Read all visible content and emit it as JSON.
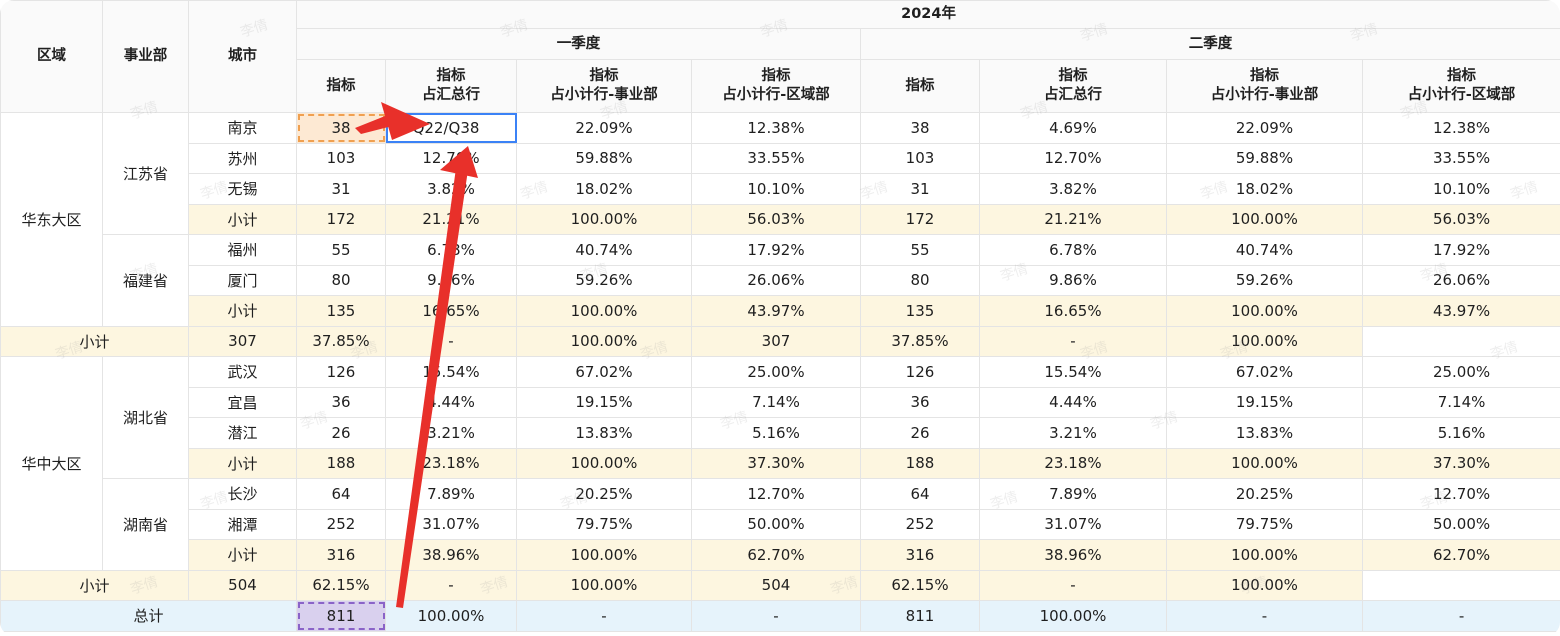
{
  "header": {
    "region": "区域",
    "bu": "事业部",
    "city": "城市",
    "year": "2024年",
    "q1": "一季度",
    "q2": "二季度",
    "metric": "指标",
    "m_total_l1": "指标",
    "m_total_l2": "占汇总行",
    "m_bu_l1": "指标",
    "m_bu_l2": "占小计行-事业部",
    "m_reg_l1": "指标",
    "m_reg_l2": "占小计行-区域部"
  },
  "formula": "=Q22/Q38",
  "rows": [
    {
      "city": "南京",
      "v": "38",
      "p1": "=Q22/Q38",
      "p2": "22.09%",
      "p3": "12.38%",
      "w": "38",
      "q1": "4.69%",
      "q2": "22.09%",
      "q3": "12.38%"
    },
    {
      "city": "苏州",
      "v": "103",
      "p1": "12.70%",
      "p2": "59.88%",
      "p3": "33.55%",
      "w": "103",
      "q1": "12.70%",
      "q2": "59.88%",
      "q3": "33.55%"
    },
    {
      "city": "无锡",
      "v": "31",
      "p1": "3.82%",
      "p2": "18.02%",
      "p3": "10.10%",
      "w": "31",
      "q1": "3.82%",
      "q2": "18.02%",
      "q3": "10.10%"
    },
    {
      "city": "小计",
      "v": "172",
      "p1": "21.21%",
      "p2": "100.00%",
      "p3": "56.03%",
      "w": "172",
      "q1": "21.21%",
      "q2": "100.00%",
      "q3": "56.03%"
    },
    {
      "city": "福州",
      "v": "55",
      "p1": "6.78%",
      "p2": "40.74%",
      "p3": "17.92%",
      "w": "55",
      "q1": "6.78%",
      "q2": "40.74%",
      "q3": "17.92%"
    },
    {
      "city": "厦门",
      "v": "80",
      "p1": "9.86%",
      "p2": "59.26%",
      "p3": "26.06%",
      "w": "80",
      "q1": "9.86%",
      "q2": "59.26%",
      "q3": "26.06%"
    },
    {
      "city": "小计",
      "v": "135",
      "p1": "16.65%",
      "p2": "100.00%",
      "p3": "43.97%",
      "w": "135",
      "q1": "16.65%",
      "q2": "100.00%",
      "q3": "43.97%"
    },
    {
      "city": "小计",
      "v": "307",
      "p1": "37.85%",
      "p2": "-",
      "p3": "100.00%",
      "w": "307",
      "q1": "37.85%",
      "q2": "-",
      "q3": "100.00%"
    },
    {
      "city": "武汉",
      "v": "126",
      "p1": "15.54%",
      "p2": "67.02%",
      "p3": "25.00%",
      "w": "126",
      "q1": "15.54%",
      "q2": "67.02%",
      "q3": "25.00%"
    },
    {
      "city": "宜昌",
      "v": "36",
      "p1": "4.44%",
      "p2": "19.15%",
      "p3": "7.14%",
      "w": "36",
      "q1": "4.44%",
      "q2": "19.15%",
      "q3": "7.14%"
    },
    {
      "city": "潜江",
      "v": "26",
      "p1": "3.21%",
      "p2": "13.83%",
      "p3": "5.16%",
      "w": "26",
      "q1": "3.21%",
      "q2": "13.83%",
      "q3": "5.16%"
    },
    {
      "city": "小计",
      "v": "188",
      "p1": "23.18%",
      "p2": "100.00%",
      "p3": "37.30%",
      "w": "188",
      "q1": "23.18%",
      "q2": "100.00%",
      "q3": "37.30%"
    },
    {
      "city": "长沙",
      "v": "64",
      "p1": "7.89%",
      "p2": "20.25%",
      "p3": "12.70%",
      "w": "64",
      "q1": "7.89%",
      "q2": "20.25%",
      "q3": "12.70%"
    },
    {
      "city": "湘潭",
      "v": "252",
      "p1": "31.07%",
      "p2": "79.75%",
      "p3": "50.00%",
      "w": "252",
      "q1": "31.07%",
      "q2": "79.75%",
      "q3": "50.00%"
    },
    {
      "city": "小计",
      "v": "316",
      "p1": "38.96%",
      "p2": "100.00%",
      "p3": "62.70%",
      "w": "316",
      "q1": "38.96%",
      "q2": "100.00%",
      "q3": "62.70%"
    },
    {
      "city": "小计",
      "v": "504",
      "p1": "62.15%",
      "p2": "-",
      "p3": "100.00%",
      "w": "504",
      "q1": "62.15%",
      "q2": "-",
      "q3": "100.00%"
    },
    {
      "city": "总计",
      "v": "811",
      "p1": "100.00%",
      "p2": "-",
      "p3": "-",
      "w": "811",
      "q1": "100.00%",
      "q2": "-",
      "q3": "-"
    }
  ],
  "regions": {
    "east": "华东大区",
    "central": "华中大区"
  },
  "bus": {
    "jiangsu": "江苏省",
    "fujian": "福建省",
    "hubei": "湖北省",
    "hunan": "湖南省"
  },
  "watermark": "李倩",
  "colors": {
    "subtotal_bg": "#fdf6e0",
    "total_bg": "#e6f3fb",
    "arrow": "#e8302a",
    "select_orange": "#f0a050",
    "select_purple": "#8a63c8",
    "edit_border": "#3b82f6"
  }
}
